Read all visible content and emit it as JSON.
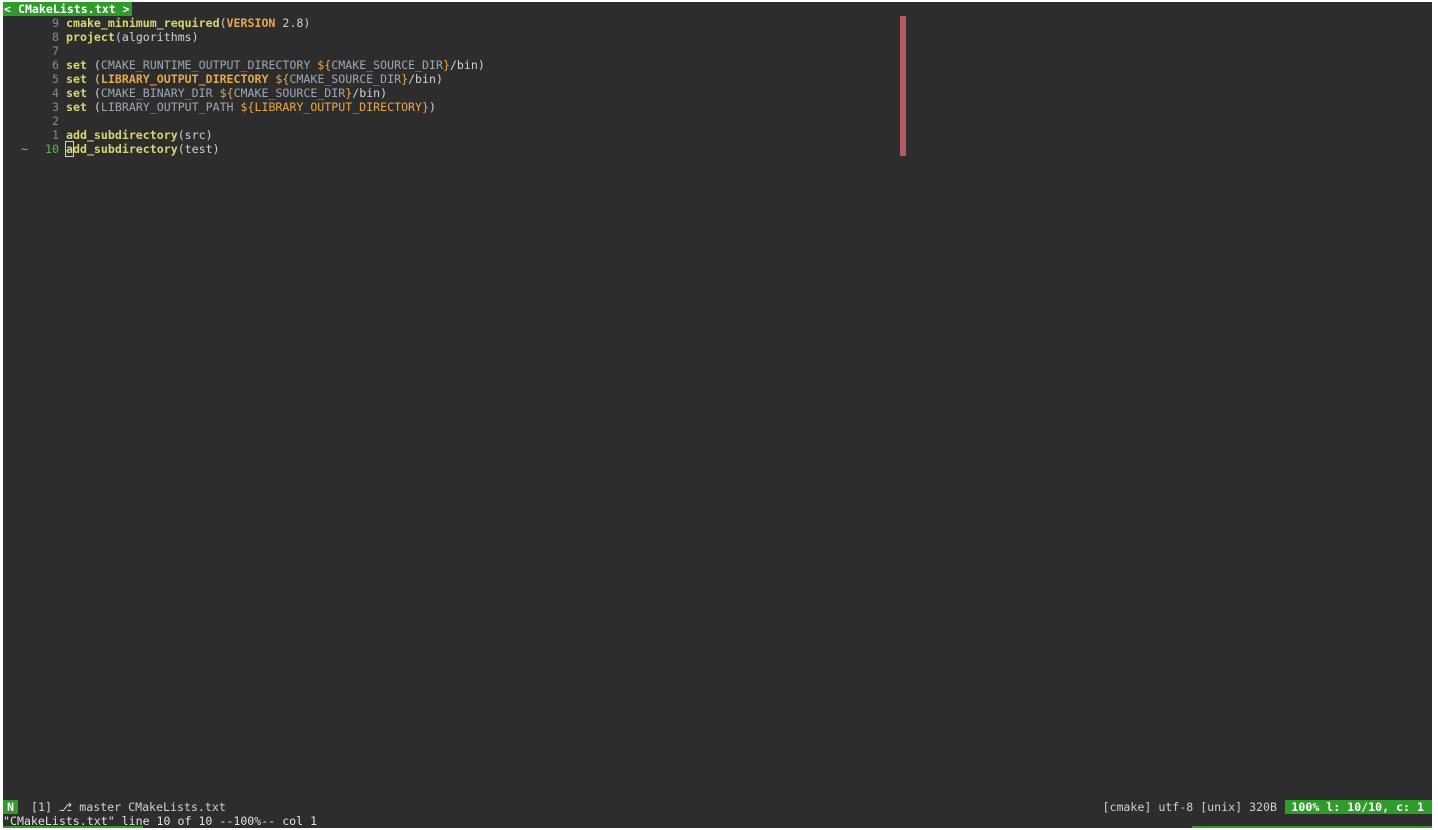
{
  "tabline": {
    "active_tab": "< CMakeLists.txt >"
  },
  "editor": {
    "lines": [
      {
        "sign": "",
        "num": "9",
        "tokens": [
          {
            "t": "cmake_minimum_required",
            "c": "cmd"
          },
          {
            "t": "(",
            "c": "plain"
          },
          {
            "t": "VERSION",
            "c": "opt"
          },
          {
            "t": " 2.8)",
            "c": "plain"
          }
        ]
      },
      {
        "sign": "",
        "num": "8",
        "tokens": [
          {
            "t": "project",
            "c": "cmd"
          },
          {
            "t": "(algorithms)",
            "c": "plain"
          }
        ]
      },
      {
        "sign": "",
        "num": "7",
        "tokens": []
      },
      {
        "sign": "",
        "num": "6",
        "tokens": [
          {
            "t": "set",
            "c": "kw"
          },
          {
            "t": " (",
            "c": "plain"
          },
          {
            "t": "CMAKE_RUNTIME_OUTPUT_DIRECTORY",
            "c": "arg"
          },
          {
            "t": " ${",
            "c": "var"
          },
          {
            "t": "CMAKE_SOURCE_DIR",
            "c": "arg"
          },
          {
            "t": "}",
            "c": "var"
          },
          {
            "t": "/bin)",
            "c": "plain"
          }
        ]
      },
      {
        "sign": "",
        "num": "5",
        "tokens": [
          {
            "t": "set",
            "c": "kw"
          },
          {
            "t": " (",
            "c": "plain"
          },
          {
            "t": "LIBRARY_OUTPUT_DIRECTORY",
            "c": "opt"
          },
          {
            "t": " ${",
            "c": "var"
          },
          {
            "t": "CMAKE_SOURCE_DIR",
            "c": "arg"
          },
          {
            "t": "}",
            "c": "var"
          },
          {
            "t": "/bin)",
            "c": "plain"
          }
        ]
      },
      {
        "sign": "",
        "num": "4",
        "tokens": [
          {
            "t": "set",
            "c": "kw"
          },
          {
            "t": " (",
            "c": "plain"
          },
          {
            "t": "CMAKE_BINARY_DIR",
            "c": "arg"
          },
          {
            "t": " ${",
            "c": "var"
          },
          {
            "t": "CMAKE_SOURCE_DIR",
            "c": "arg"
          },
          {
            "t": "}",
            "c": "var"
          },
          {
            "t": "/bin)",
            "c": "plain"
          }
        ]
      },
      {
        "sign": "",
        "num": "3",
        "tokens": [
          {
            "t": "set",
            "c": "kw"
          },
          {
            "t": " (",
            "c": "plain"
          },
          {
            "t": "LIBRARY_OUTPUT_PATH",
            "c": "arg"
          },
          {
            "t": " ${LIBRARY_OUTPUT_DIRECTORY}",
            "c": "var"
          },
          {
            "t": ")",
            "c": "plain"
          }
        ]
      },
      {
        "sign": "",
        "num": "2",
        "tokens": []
      },
      {
        "sign": "",
        "num": "1",
        "tokens": [
          {
            "t": "add_subdirectory",
            "c": "cmd"
          },
          {
            "t": "(src)",
            "c": "plain"
          }
        ]
      },
      {
        "sign": "~",
        "num": "10",
        "current": true,
        "tokens": [
          {
            "t": "a",
            "c": "cmd",
            "cursor": true
          },
          {
            "t": "dd_subdirectory",
            "c": "cmd"
          },
          {
            "t": "(test)",
            "c": "plain"
          }
        ]
      }
    ]
  },
  "statusline": {
    "mode": "N",
    "left": "[1] ⎇ master CMakeLists.txt",
    "right": "[cmake] utf-8 [unix] 320B",
    "position": "100% l: 10/10, c: 1"
  },
  "cmdline": {
    "text": "\"CMakeLists.txt\" line 10 of 10 --100%-- col 1"
  },
  "colors": {
    "background": "#2d2d2d",
    "accent_green": "#2e9b2a",
    "colorcolumn": "#b55a63"
  }
}
